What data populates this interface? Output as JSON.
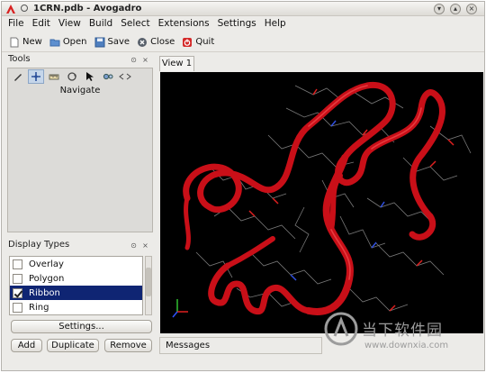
{
  "window": {
    "title": "1CRN.pdb - Avogadro"
  },
  "menu": [
    "File",
    "Edit",
    "View",
    "Build",
    "Select",
    "Extensions",
    "Settings",
    "Help"
  ],
  "toolbar": {
    "new_label": "New",
    "open_label": "Open",
    "save_label": "Save",
    "close_label": "Close",
    "quit_label": "Quit"
  },
  "tools_panel": {
    "title": "Tools",
    "active_tool_label": "Navigate",
    "tool_icons": [
      "draw-icon",
      "navigate-icon",
      "measure-icon",
      "manipulate-icon",
      "select-icon",
      "bond-centric-icon"
    ]
  },
  "display_types": {
    "title": "Display Types",
    "items": [
      {
        "label": "Overlay",
        "checked": false,
        "selected": false
      },
      {
        "label": "Polygon",
        "checked": false,
        "selected": false
      },
      {
        "label": "Ribbon",
        "checked": true,
        "selected": true
      },
      {
        "label": "Ring",
        "checked": false,
        "selected": false
      }
    ],
    "settings_label": "Settings...",
    "add_label": "Add",
    "duplicate_label": "Duplicate",
    "remove_label": "Remove"
  },
  "view": {
    "tab_label": "View 1"
  },
  "messages": {
    "label": "Messages"
  },
  "watermark": {
    "text": "当下软件园",
    "url": "www.downxia.com"
  },
  "colors": {
    "ribbon": "#d0101a",
    "selection": "#0f2573",
    "viewport_bg": "#000000"
  }
}
